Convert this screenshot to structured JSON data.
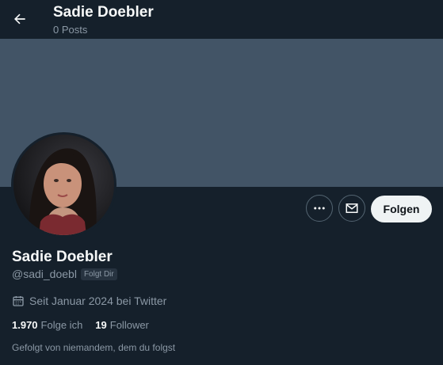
{
  "header": {
    "title": "Sadie Doebler",
    "subtitle": "0 Posts",
    "back_icon": "arrow-left-icon"
  },
  "profile": {
    "display_name": "Sadie Doebler",
    "handle": "@sadi_doebl",
    "follows_you_badge": "Folgt Dir",
    "joined": "Seit Januar 2024 bei Twitter",
    "following_count": "1.970",
    "following_label": "Folge ich",
    "followers_count": "19",
    "followers_label": "Follower",
    "followed_by": "Gefolgt von niemandem, dem du folgst"
  },
  "actions": {
    "more_icon": "more-horizontal-icon",
    "message_icon": "mail-icon",
    "follow_label": "Folgen"
  },
  "colors": {
    "background": "#15202b",
    "banner": "#425466",
    "follow_button": "#eff3f4",
    "muted_text": "#8b98a5"
  }
}
